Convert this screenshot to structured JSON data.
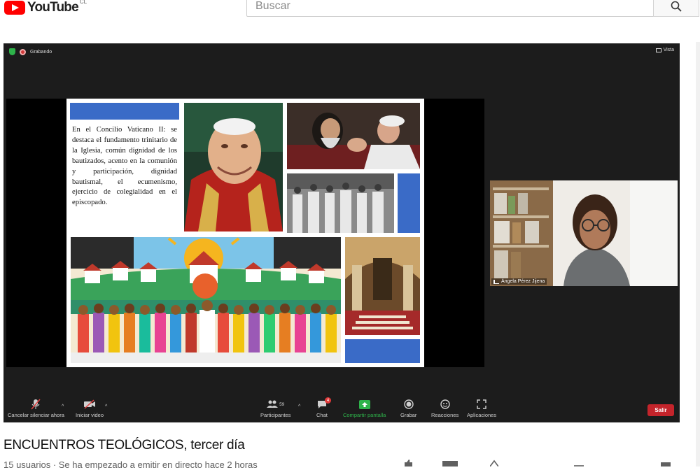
{
  "youtube": {
    "logo_text": "YouTube",
    "region_code": "CL",
    "search_placeholder": "Buscar",
    "search_icon": "search-icon"
  },
  "meeting": {
    "recording_label": "Grabando",
    "view_label": "Vista",
    "participant_name": "Ángela Pérez Jijena"
  },
  "slide": {
    "text": "En el Concilio Vaticano II: se destaca el fundamento trinitario de la Iglesia, común dignidad de los bautizados, acento en la comunión y participación, dignidad bautismal, el ecumenismo, ejercicio de colegialidad en el episcopado.",
    "accent_color": "#3a6bc7"
  },
  "toolbar": {
    "unmute_label": "Cancelar silenciar ahora",
    "start_video_label": "Iniciar video",
    "participants_label": "Participantes",
    "participants_count": "59",
    "chat_label": "Chat",
    "chat_badge": "4",
    "share_label": "Compartir pantalla",
    "record_label": "Grabar",
    "reactions_label": "Reacciones",
    "apps_label": "Aplicaciones",
    "leave_label": "Salir",
    "share_color": "#2eb34a",
    "leave_color": "#c4242b"
  },
  "video": {
    "title": "ENCUENTROS TEOLÓGICOS, tercer día",
    "meta": "15 usuarios · Se ha empezado a emitir en directo hace 2 horas"
  }
}
